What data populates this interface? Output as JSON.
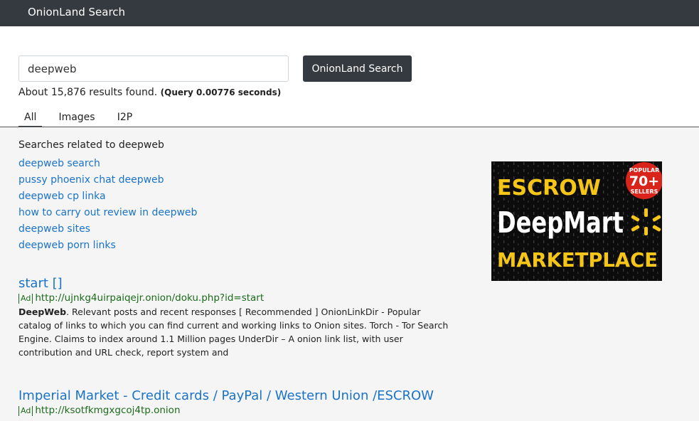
{
  "header": {
    "brand": "OnionLand Search"
  },
  "search": {
    "query": "deepweb",
    "button_label": "OnionLand Search",
    "results_text": "About 15,876 results found.",
    "query_time": "(Query 0.00776 seconds)"
  },
  "tabs": [
    {
      "label": "All",
      "active": true
    },
    {
      "label": "Images",
      "active": false
    },
    {
      "label": "I2P",
      "active": false
    }
  ],
  "related": {
    "heading": "Searches related to deepweb",
    "items": [
      "deepweb search",
      "pussy phoenix chat deepweb",
      "deepweb cp linka",
      "how to carry out review in deepweb",
      "deepweb sites",
      "deepweb porn links"
    ]
  },
  "ad_banner": {
    "line1": "ESCROW",
    "brand": "DeepMart",
    "line3": "MARKETPLACE",
    "badge_top": "POPULAR",
    "badge_num": "70+",
    "badge_bottom": "SELLERS",
    "colors": {
      "yellow": "#f5c518",
      "red": "#d9241c",
      "background": "#0c0c0c"
    }
  },
  "results": [
    {
      "title": "start []",
      "ad_label": "Ad",
      "url": "http://ujnkg4uirpaiqejr.onion/doku.php?id=start",
      "snippet_bold": "DeepWeb",
      "snippet_rest": ". Relevant posts and recent responses [ Recommended ] OnionLinkDir - Popular catalog of links to which you can find current and working links to Onion sites. Torch - Tor Search Engine. Claims to index around 1.1 Million pages UnderDir – A onion link list, with user contribution and URL check, report system and"
    },
    {
      "title": "Imperial Market - Credit cards / PayPal / Western Union /ESCROW",
      "ad_label": "Ad",
      "url": "http://ksotfkmgxgcoj4tp.onion"
    }
  ]
}
